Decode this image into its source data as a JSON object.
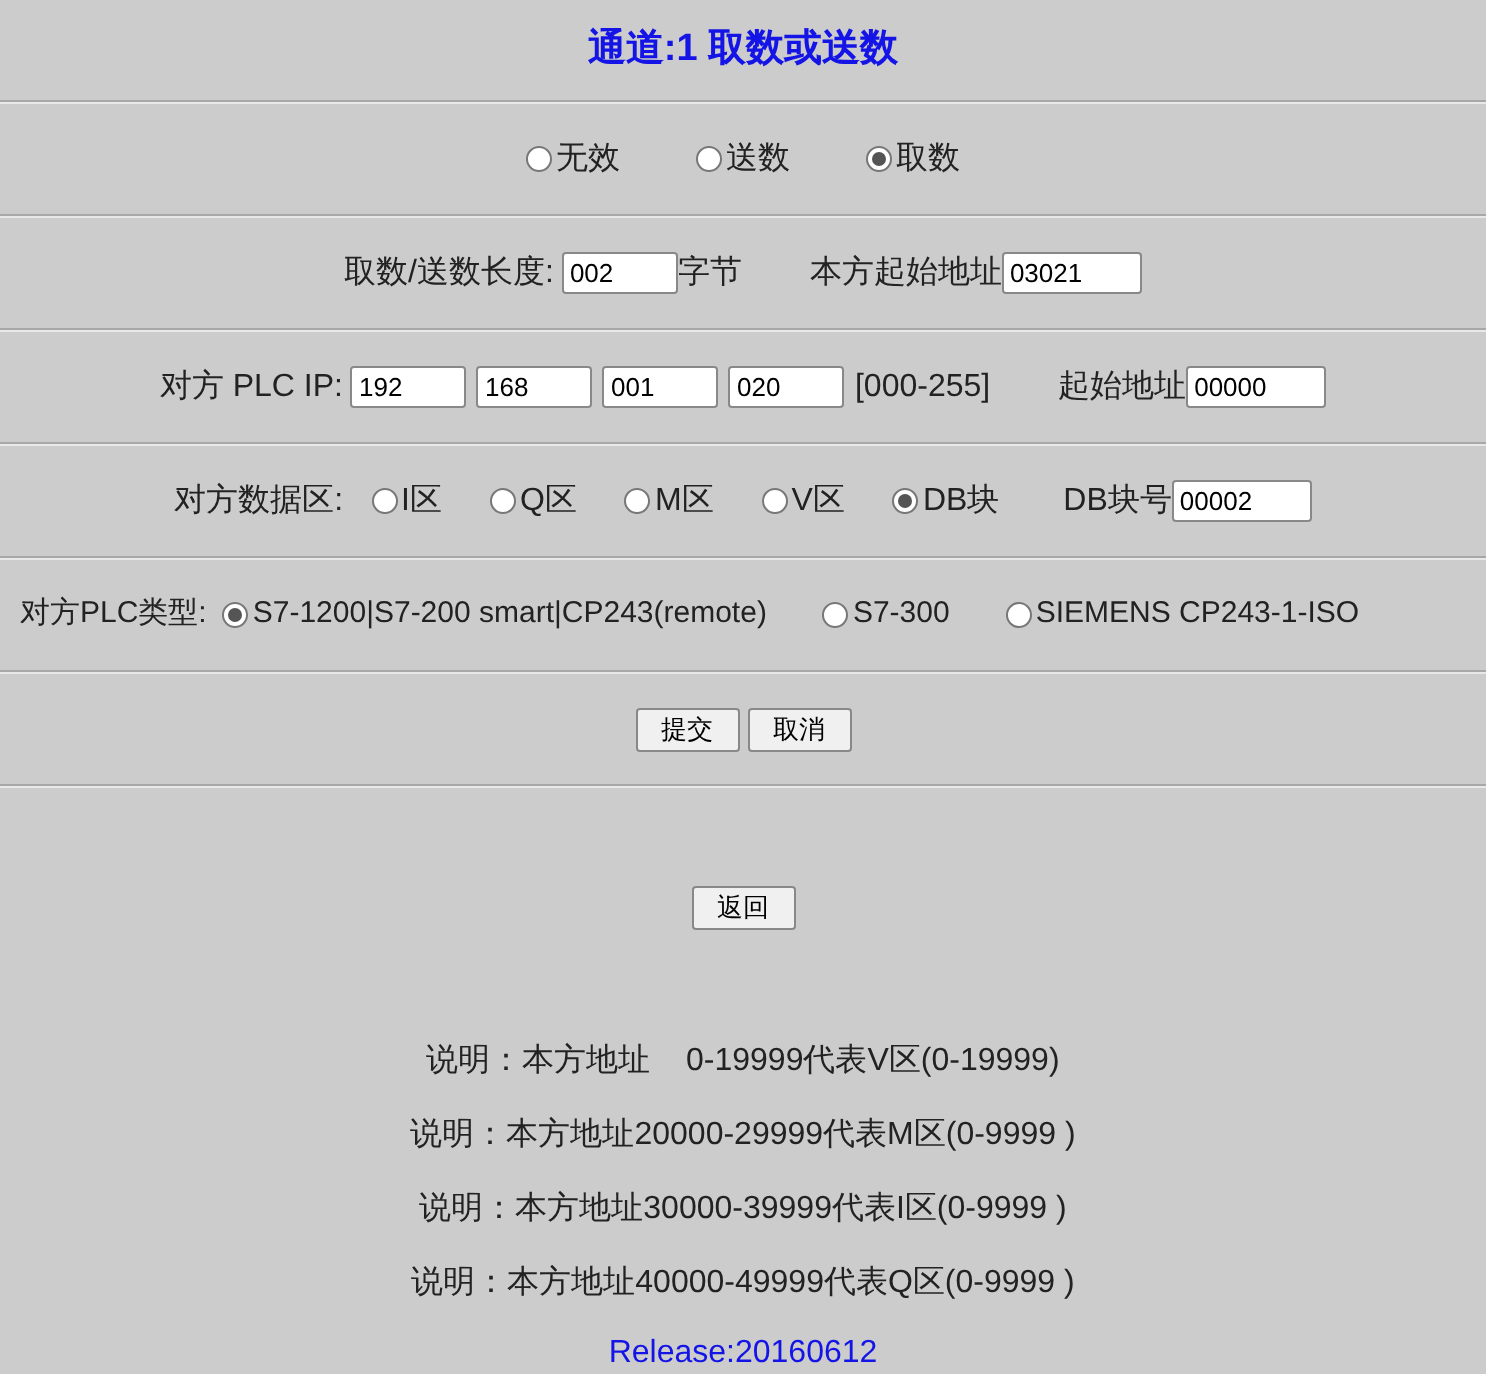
{
  "title": "通道:1 取数或送数",
  "mode_options": [
    {
      "label": "无效",
      "selected": false
    },
    {
      "label": "送数",
      "selected": false
    },
    {
      "label": "取数",
      "selected": true
    }
  ],
  "length_row": {
    "label": "取数/送数长度:",
    "value": "002",
    "unit": "字节",
    "address_label": "本方起始地址",
    "address_value": "03021"
  },
  "ip_row": {
    "label": "对方 PLC IP:",
    "octets": [
      "192",
      "168",
      "001",
      "020"
    ],
    "range": "[000-255]",
    "address_label": "起始地址",
    "address_value": "00000"
  },
  "area_row": {
    "label": "对方数据区:",
    "options": [
      {
        "label": "I区",
        "selected": false
      },
      {
        "label": "Q区",
        "selected": false
      },
      {
        "label": "M区",
        "selected": false
      },
      {
        "label": "V区",
        "selected": false
      },
      {
        "label": "DB块",
        "selected": true
      }
    ],
    "db_label": "DB块号",
    "db_value": "00002"
  },
  "plc_type_row": {
    "label": "对方PLC类型:",
    "options": [
      {
        "label": "S7-1200|S7-200 smart|CP243(remote)",
        "selected": true
      },
      {
        "label": "S7-300",
        "selected": false
      },
      {
        "label": "SIEMENS CP243-1-ISO",
        "selected": false
      }
    ]
  },
  "buttons": [
    "提交",
    "取消"
  ],
  "back_button": "返回",
  "notes": [
    "说明：本方地址    0-19999代表V区(0-19999)",
    "说明：本方地址20000-29999代表M区(0-9999 )",
    "说明：本方地址30000-39999代表I区(0-9999 )",
    "说明：本方地址40000-49999代表Q区(0-9999 )"
  ],
  "release": "Release:20160612"
}
